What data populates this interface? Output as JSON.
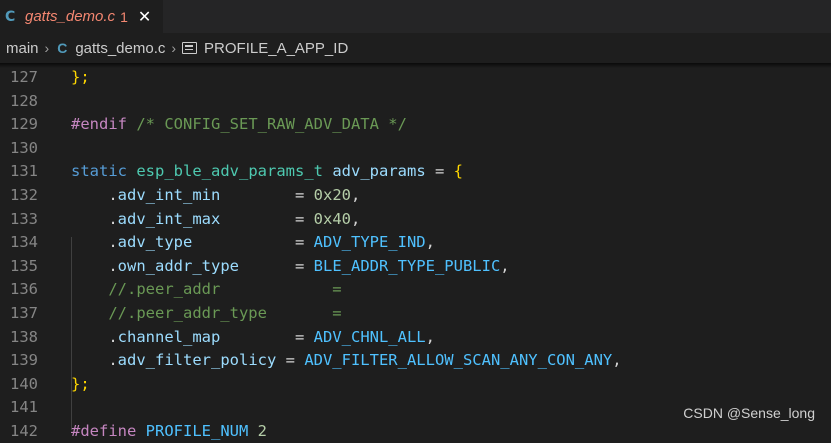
{
  "tab": {
    "icon": "C",
    "filename": "gatts_demo.c",
    "problems": "1",
    "close": "✕"
  },
  "breadcrumb": {
    "branch": "main",
    "file_icon": "C",
    "file": "gatts_demo.c",
    "symbol": "PROFILE_A_APP_ID"
  },
  "colors": {
    "keyword": "#569cd6",
    "type": "#4ec9b0",
    "variable": "#9cdcfe",
    "number": "#b5cea8",
    "constant": "#4fc1ff",
    "comment": "#6a9955",
    "preprocessor": "#c586c0",
    "brace": "#ffd700",
    "punct": "#d4d4d4"
  },
  "lines": [
    {
      "n": "127",
      "tokens": [
        {
          "t": "};",
          "c": "brace"
        }
      ]
    },
    {
      "n": "128",
      "tokens": []
    },
    {
      "n": "129",
      "tokens": [
        {
          "t": "#endif",
          "c": "preprocessor"
        },
        {
          "t": " /* CONFIG_SET_RAW_ADV_DATA */",
          "c": "comment"
        }
      ]
    },
    {
      "n": "130",
      "tokens": []
    },
    {
      "n": "131",
      "tokens": [
        {
          "t": "static",
          "c": "keyword"
        },
        {
          "t": " ",
          "c": "punct"
        },
        {
          "t": "esp_ble_adv_params_t",
          "c": "type"
        },
        {
          "t": " ",
          "c": "punct"
        },
        {
          "t": "adv_params",
          "c": "variable"
        },
        {
          "t": " = ",
          "c": "punct"
        },
        {
          "t": "{",
          "c": "brace"
        }
      ]
    },
    {
      "n": "132",
      "tokens": [
        {
          "t": "    .",
          "c": "punct"
        },
        {
          "t": "adv_int_min",
          "c": "variable"
        },
        {
          "t": "        = ",
          "c": "punct"
        },
        {
          "t": "0x20",
          "c": "number"
        },
        {
          "t": ",",
          "c": "punct"
        }
      ]
    },
    {
      "n": "133",
      "tokens": [
        {
          "t": "    .",
          "c": "punct"
        },
        {
          "t": "adv_int_max",
          "c": "variable"
        },
        {
          "t": "        = ",
          "c": "punct"
        },
        {
          "t": "0x40",
          "c": "number"
        },
        {
          "t": ",",
          "c": "punct"
        }
      ]
    },
    {
      "n": "134",
      "tokens": [
        {
          "t": "    .",
          "c": "punct"
        },
        {
          "t": "adv_type",
          "c": "variable"
        },
        {
          "t": "           = ",
          "c": "punct"
        },
        {
          "t": "ADV_TYPE_IND",
          "c": "constant"
        },
        {
          "t": ",",
          "c": "punct"
        }
      ]
    },
    {
      "n": "135",
      "tokens": [
        {
          "t": "    .",
          "c": "punct"
        },
        {
          "t": "own_addr_type",
          "c": "variable"
        },
        {
          "t": "      = ",
          "c": "punct"
        },
        {
          "t": "BLE_ADDR_TYPE_PUBLIC",
          "c": "constant"
        },
        {
          "t": ",",
          "c": "punct"
        }
      ]
    },
    {
      "n": "136",
      "tokens": [
        {
          "t": "    //.peer_addr            =",
          "c": "comment"
        }
      ]
    },
    {
      "n": "137",
      "tokens": [
        {
          "t": "    //.peer_addr_type       =",
          "c": "comment"
        }
      ]
    },
    {
      "n": "138",
      "tokens": [
        {
          "t": "    .",
          "c": "punct"
        },
        {
          "t": "channel_map",
          "c": "variable"
        },
        {
          "t": "        = ",
          "c": "punct"
        },
        {
          "t": "ADV_CHNL_ALL",
          "c": "constant"
        },
        {
          "t": ",",
          "c": "punct"
        }
      ]
    },
    {
      "n": "139",
      "tokens": [
        {
          "t": "    .",
          "c": "punct"
        },
        {
          "t": "adv_filter_policy",
          "c": "variable"
        },
        {
          "t": " = ",
          "c": "punct"
        },
        {
          "t": "ADV_FILTER_ALLOW_SCAN_ANY_CON_ANY",
          "c": "constant"
        },
        {
          "t": ",",
          "c": "punct"
        }
      ]
    },
    {
      "n": "140",
      "tokens": [
        {
          "t": "};",
          "c": "brace"
        }
      ]
    },
    {
      "n": "141",
      "tokens": []
    },
    {
      "n": "142",
      "tokens": [
        {
          "t": "#define",
          "c": "preprocessor"
        },
        {
          "t": " PROFILE_NUM ",
          "c": "constant"
        },
        {
          "t": "2",
          "c": "number"
        }
      ]
    }
  ],
  "watermark": "CSDN @Sense_long"
}
